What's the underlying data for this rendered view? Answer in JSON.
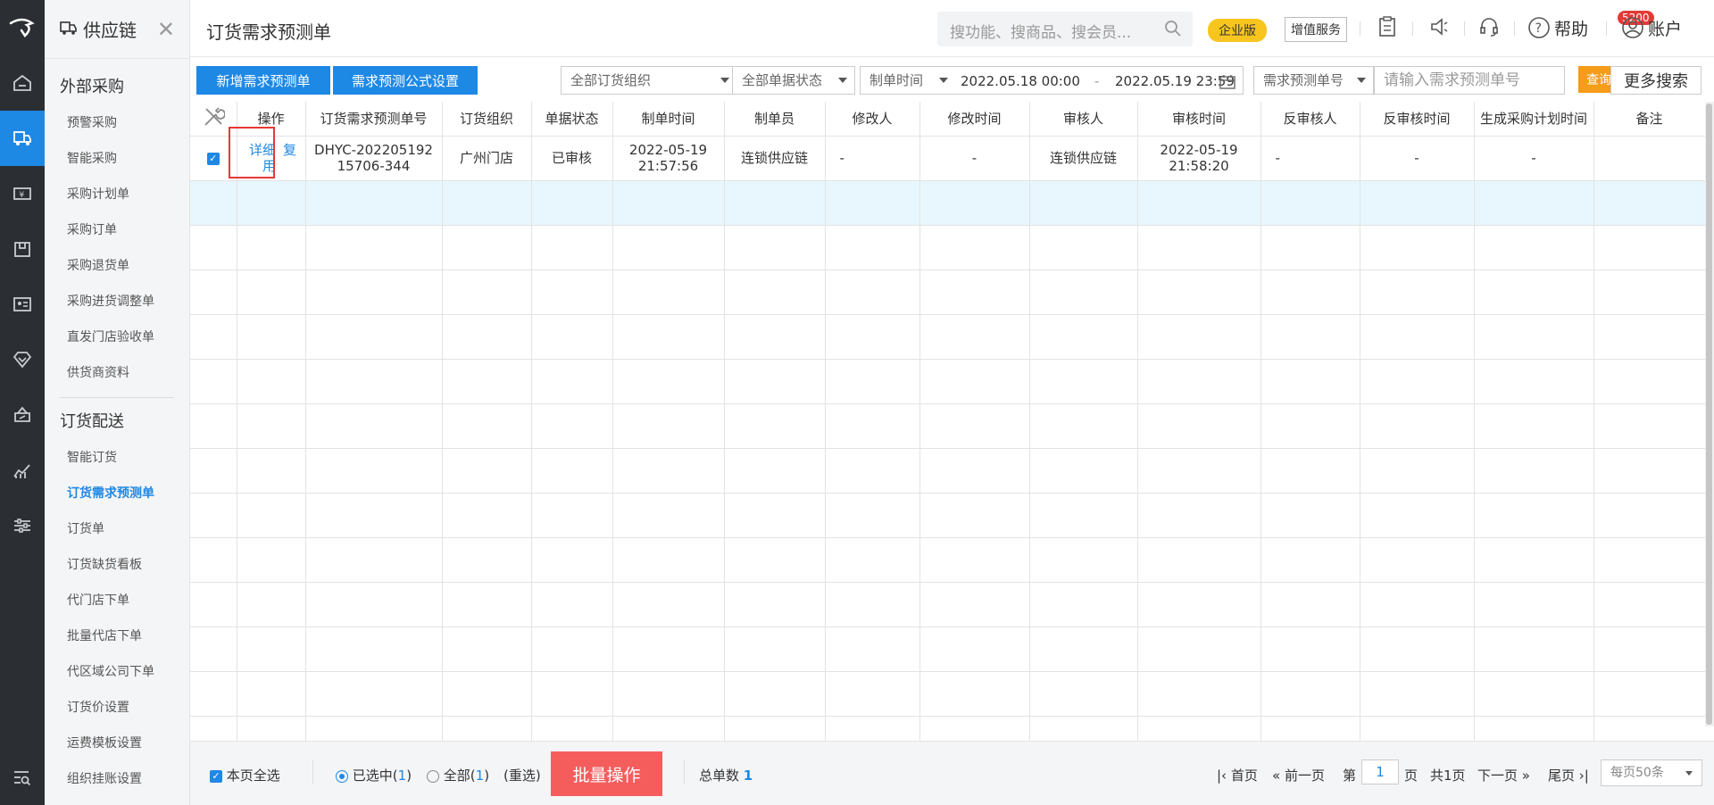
{
  "app": {
    "module": "供应链",
    "page_title": "订货需求预测单"
  },
  "menu": {
    "groups": [
      {
        "label": "外部采购",
        "items": [
          "预警采购",
          "智能采购",
          "采购计划单",
          "采购订单",
          "采购退货单",
          "采购进货调整单",
          "直发门店验收单",
          "供货商资料"
        ]
      },
      {
        "label": "订货配送",
        "items": [
          "智能订货",
          "订货需求预测单",
          "订货单",
          "订货缺货看板",
          "代门店下单",
          "批量代店下单",
          "代区域公司下单",
          "订货价设置",
          "运费模板设置",
          "组织挂账设置"
        ]
      }
    ],
    "active_item": "订货需求预测单"
  },
  "header": {
    "search_placeholder": "搜功能、搜商品、搜会员...",
    "edition": "企业版",
    "value_added": "增值服务",
    "notification_count": "5200",
    "help": "帮助",
    "account": "账户"
  },
  "toolbar": {
    "add_label": "新增需求预测单",
    "formula_label": "需求预测公式设置",
    "org_select": "全部订货组织",
    "status_select": "全部单据状态",
    "time_select": "制单时间",
    "date_from": "2022.05.18 00:00",
    "date_sep": "-",
    "date_to": "2022.05.19 23:59",
    "field_select": "需求预测单号",
    "input_placeholder": "请输入需求预测单号",
    "query_label": "查询",
    "more_label": "更多搜索"
  },
  "table": {
    "headers": [
      "操作",
      "订货需求预测单号",
      "订货组织",
      "单据状态",
      "制单时间",
      "制单员",
      "修改人",
      "修改时间",
      "审核人",
      "审核时间",
      "反审核人",
      "反审核时间",
      "生成采购计划时间",
      "备注"
    ],
    "row": {
      "action_detail": "详细",
      "action_reuse": "复用",
      "no": "DHYC-20220519215706-344",
      "org": "广州门店",
      "status": "已审核",
      "created_date": "2022-05-19",
      "created_time": "21:57:56",
      "creator": "连锁供应链",
      "modifier": "-",
      "modified_time": "-",
      "auditor": "连锁供应链",
      "audit_date": "2022-05-19",
      "audit_time": "21:58:20",
      "unauditor": "-",
      "unaudit_time": "-",
      "plan_time": "-",
      "remark": ""
    }
  },
  "footer": {
    "select_page": "本页全选",
    "selected_label": "已选中(",
    "selected_count": "1",
    "all_label": "全部(",
    "all_count": "1",
    "close_paren": ")",
    "reselect": "(重选)",
    "batch": "批量操作",
    "total_label": "总单数",
    "total": "1",
    "first": "首页",
    "prev": "前一页",
    "page_prefix": "第",
    "page": "1",
    "page_suffix": "页",
    "total_pages": "共1页",
    "next": "下一页",
    "last": "尾页",
    "page_size": "每页50条"
  }
}
